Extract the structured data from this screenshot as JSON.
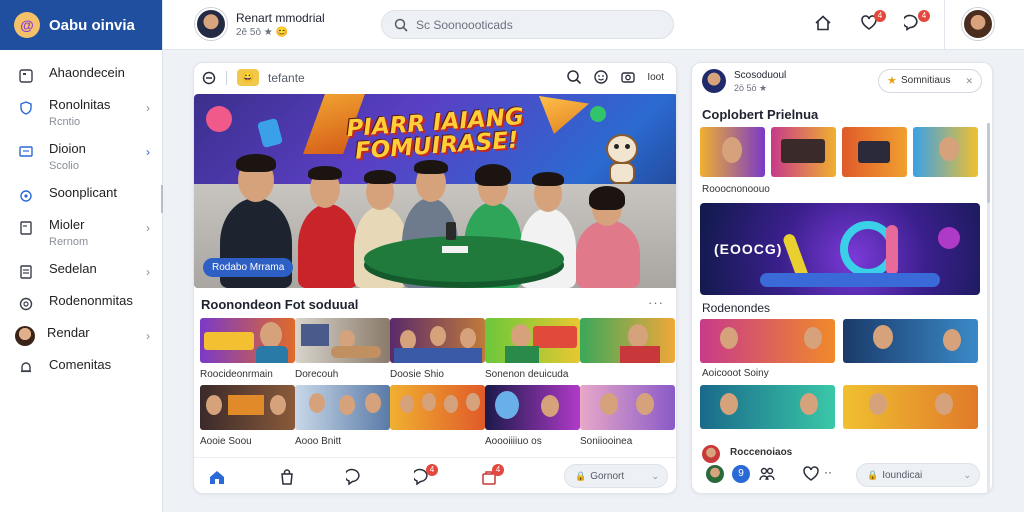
{
  "app": {
    "name": "Oabu oinvia",
    "logo_glyph": "@",
    "colors": {
      "brand": "#1f4f9e",
      "accent": "#2a6ad8",
      "badge": "#e2483d",
      "hero_title": "#ffcf3a"
    }
  },
  "sidebar": {
    "items": [
      {
        "label": "Ahaondecein",
        "sub": "",
        "icon": "square-icon",
        "chevron": false
      },
      {
        "label": "Ronolnitas",
        "sub": "Rcntio",
        "icon": "shield-icon",
        "chevron": true
      },
      {
        "label": "Dioion",
        "sub": "Scolio",
        "icon": "monitor-icon",
        "chevron": true,
        "active": true
      },
      {
        "label": "Soonplicant",
        "sub": "",
        "icon": "refresh-icon",
        "chevron": false
      },
      {
        "label": "Mioler",
        "sub": "Rernom",
        "icon": "document-icon",
        "chevron": true
      },
      {
        "label": "Sedelan",
        "sub": "",
        "icon": "document-icon",
        "chevron": true
      },
      {
        "label": "Rodenonmitas",
        "sub": "",
        "icon": "target-icon",
        "chevron": false
      },
      {
        "label": "Rendar",
        "sub": "",
        "icon": "avatar",
        "chevron": true
      },
      {
        "label": "Comenitas",
        "sub": "",
        "icon": "bell-icon",
        "chevron": false
      }
    ]
  },
  "topbar": {
    "profile_name": "Renart mmodrial",
    "profile_meta": "2ē 5ō ★ 😊",
    "search_placeholder": "Sc Soonoooticads",
    "notifications": {
      "heart_badge": "4",
      "chat_badge": "4"
    }
  },
  "main": {
    "toolbar": {
      "emoji": "😀",
      "title": "tefante",
      "right_label": "Ioot"
    },
    "hero": {
      "title_line1": "PIARR IAIANG",
      "title_line2": "FOMUIRASE!",
      "tag": "Rodabo Mrrama"
    },
    "section_title": "Roonondeon Fot soduual",
    "section_more": "···",
    "row1": [
      {
        "caption": "Roocideonrmain"
      },
      {
        "caption": "Dorecouh"
      },
      {
        "caption": "Doosie Shio"
      },
      {
        "caption": "Sonenon deuicuda"
      },
      {
        "caption": ""
      }
    ],
    "row2": [
      {
        "caption": "Aooie Soou"
      },
      {
        "caption": "Aooo Bnitt"
      },
      {
        "caption": ""
      },
      {
        "caption": "Aoooiiiiuo os"
      },
      {
        "caption": "Soniiooinea"
      }
    ],
    "bottom_nav": {
      "chat_badge": "4",
      "store_badge": "4",
      "pill_label": "Gornort"
    }
  },
  "side": {
    "header_name": "Scosoduoul",
    "header_meta": "2ō 5ō ★",
    "button_label": "Somnitiaus",
    "section_title": "Coplobert Prielnua",
    "row_caption": "Rooocnonoouo",
    "feature_label": "(EOOCG)",
    "section2_title": "Rodenondes",
    "caption3": "Aoicooot Soiny",
    "bottom_title": "Roccenoiaos",
    "bottom_pill": "Ioundicai",
    "bottom_badge": "9"
  }
}
